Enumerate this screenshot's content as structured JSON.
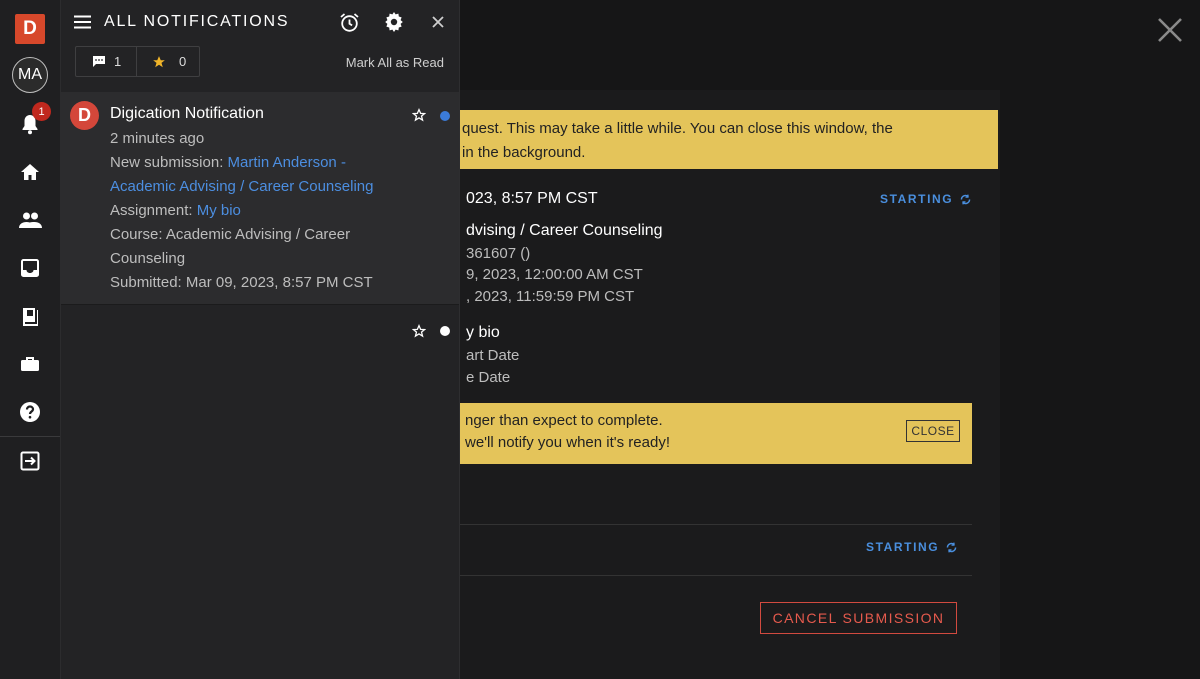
{
  "rail": {
    "logo": "D",
    "avatar": "MA",
    "notification_count": "1"
  },
  "panel": {
    "title": "ALL NOTIFICATIONS",
    "comments_count": "1",
    "stars_count": "0",
    "mark_all_read": "Mark All as Read",
    "notifications": [
      {
        "avatar": "D",
        "title": "Digication Notification",
        "time": "2 minutes ago",
        "submission_label": "New submission: ",
        "submission_link_1": "Martin Anderson -",
        "submission_link_2": "Academic Advising / Career Counseling",
        "assignment_label": "Assignment: ",
        "assignment_link": "My bio",
        "course_1": "Course: Academic Advising / Career",
        "course_2": "Counseling",
        "submitted": "Submitted: Mar 09, 2023, 8:57 PM CST"
      }
    ]
  },
  "modal": {
    "banner_line1": "quest. This may take a little while. You can close this window, the",
    "banner_line2": "in the background.",
    "submitted_time": "023, 8:57 PM CST",
    "status_1": "STARTING",
    "course": "dvising / Career Counseling",
    "id_line": "361607 ()",
    "start_line": "9, 2023, 12:00:00 AM CST",
    "end_line": ", 2023, 11:59:59 PM CST",
    "assignment": "y bio",
    "start_date": "art Date",
    "due_date": "e Date",
    "warn_line1": "nger than expect to complete.",
    "warn_line2": "we'll notify you when it's ready!",
    "warn_close": "CLOSE",
    "status_2": "STARTING",
    "cancel": "CANCEL SUBMISSION"
  },
  "colors": {
    "accent_link": "#4c8ee0",
    "brand": "#d7482b",
    "warning_banner": "#e4c45a",
    "cancel": "#e65a4d"
  }
}
